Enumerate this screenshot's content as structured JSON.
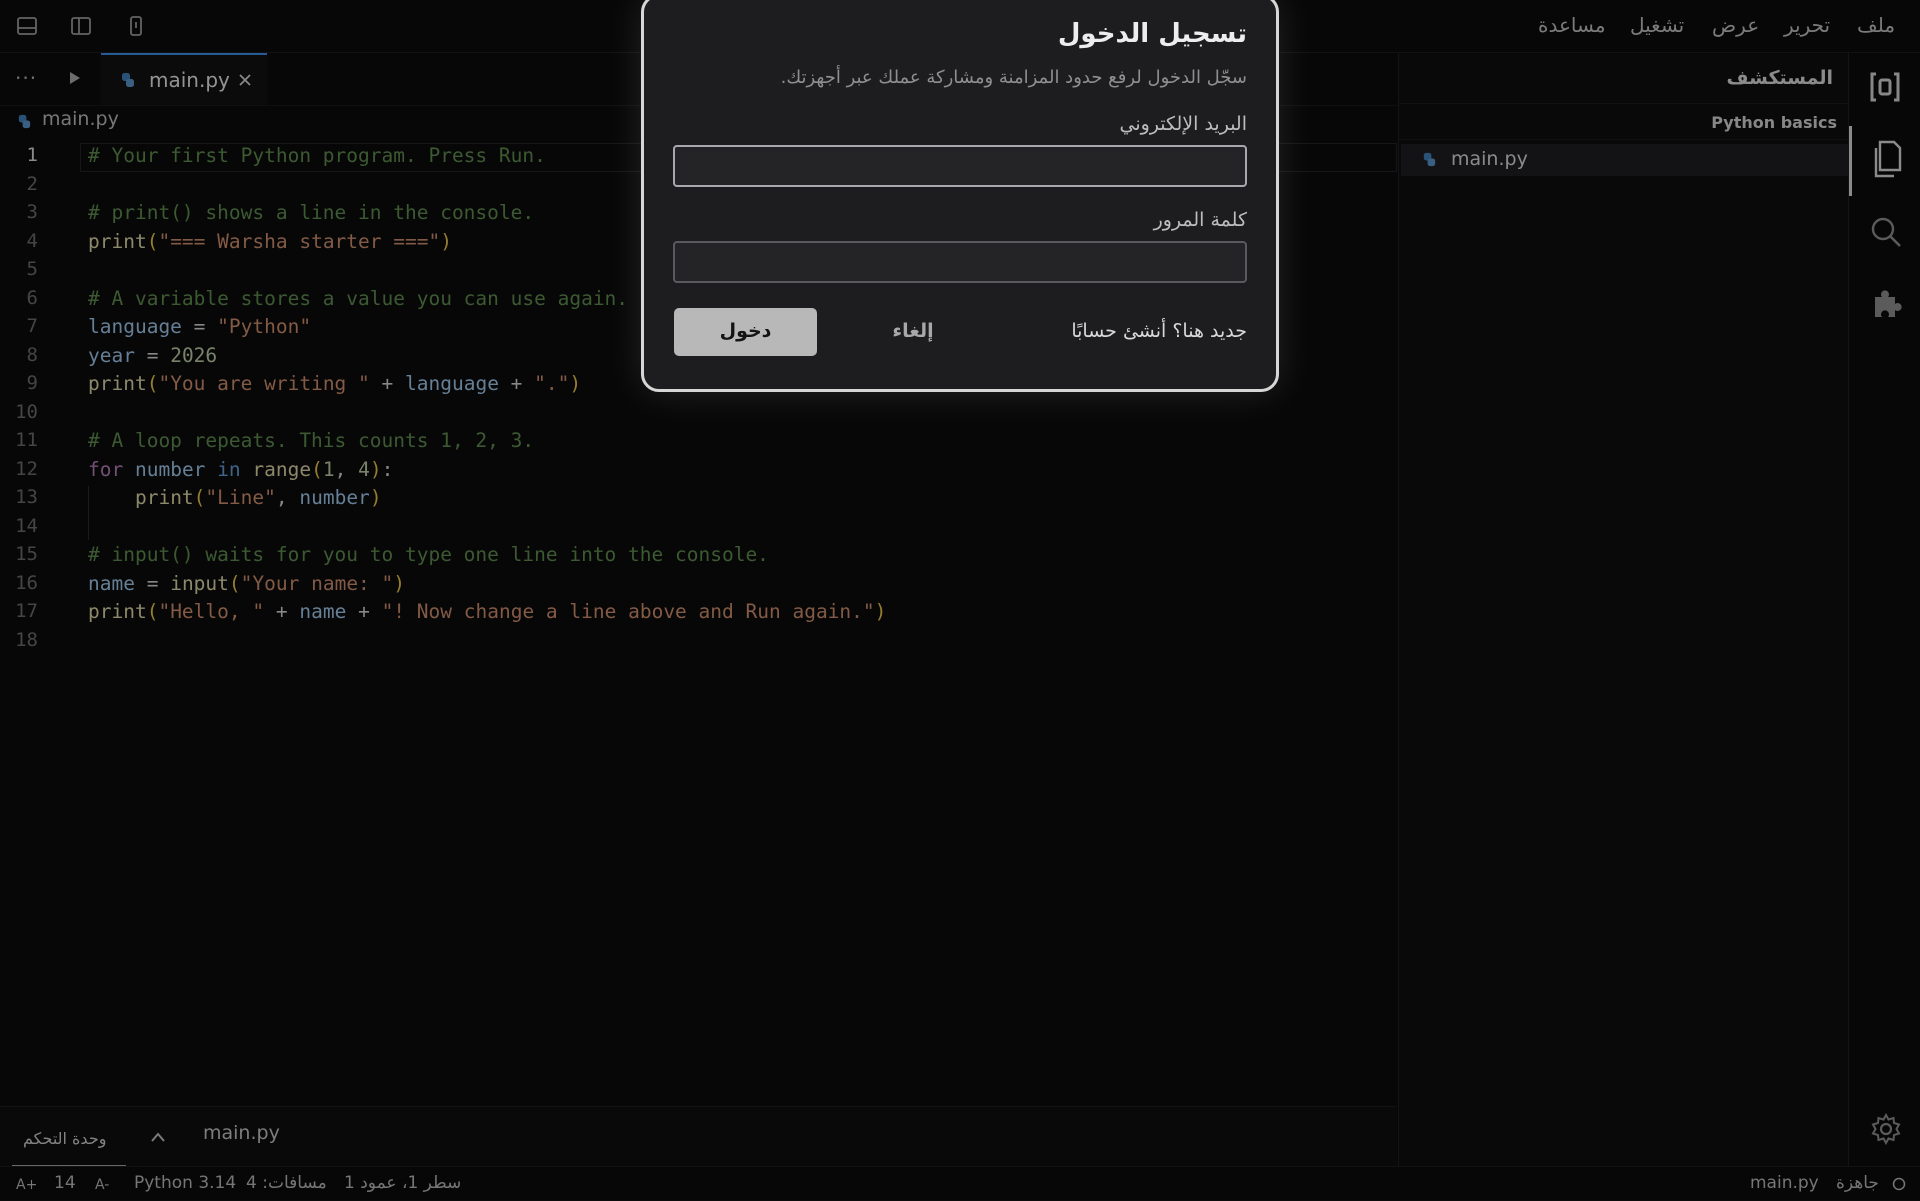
{
  "menubar": {
    "items": [
      "ملف",
      "تحرير",
      "عرض",
      "تشغيل",
      "مساعدة"
    ]
  },
  "tabs": {
    "active_file": "main.py"
  },
  "breadcrumb": "main.py",
  "editor": {
    "line_numbers": [
      "1",
      "2",
      "3",
      "4",
      "5",
      "6",
      "7",
      "8",
      "9",
      "10",
      "11",
      "12",
      "13",
      "14",
      "15",
      "16",
      "17",
      "18"
    ]
  },
  "explorer": {
    "title": "المستكشف",
    "project": "Python basics",
    "files": [
      "main.py"
    ]
  },
  "panel": {
    "console_tab": "وحدة التحكم",
    "file_label": "main.py"
  },
  "status": {
    "ready": "جاهزة",
    "file": "main.py",
    "position": "سطر 1، عمود 1",
    "spaces": "مسافات: 4",
    "language": "Python 3.14",
    "font_decrease": "A-",
    "font_size": "14",
    "font_increase": "A+"
  },
  "dialog": {
    "title": "تسجيل الدخول",
    "subtitle": "سجّل الدخول لرفع حدود المزامنة ومشاركة عملك عبر أجهزتك.",
    "email_label": "البريد الإلكتروني",
    "password_label": "كلمة المرور",
    "signup_link": "جديد هنا؟ أنشئ حسابًا",
    "cancel_label": "إلغاء",
    "login_label": "دخول"
  },
  "colors": {
    "accent": "#3a8ee6",
    "python_icon": "#4a8bc4",
    "comment": "#5d8a4e",
    "string": "#c98b6a"
  },
  "icons": [
    "panel-bottom-icon",
    "sidebar-icon",
    "device-icon",
    "more-icon",
    "run-icon",
    "python-icon",
    "close-icon",
    "chevron-up-icon",
    "logo-icon",
    "files-icon",
    "search-icon",
    "extensions-icon",
    "gear-icon",
    "circle-icon"
  ]
}
